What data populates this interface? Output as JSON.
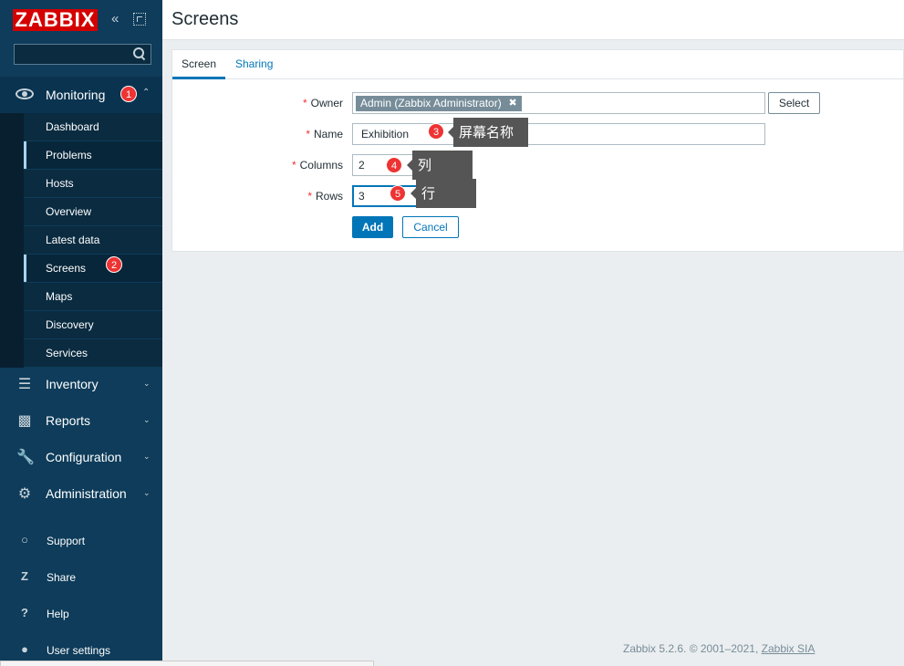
{
  "app": {
    "logo_text": "ZABBIX",
    "brand_color": "#d40000",
    "accent_color": "#0275b8"
  },
  "sidebar": {
    "search": {
      "placeholder": "",
      "value": ""
    },
    "monitoring": {
      "label": "Monitoring",
      "badge": "1",
      "items": [
        {
          "label": "Dashboard"
        },
        {
          "label": "Problems"
        },
        {
          "label": "Hosts"
        },
        {
          "label": "Overview"
        },
        {
          "label": "Latest data"
        },
        {
          "label": "Screens",
          "badge": "2"
        },
        {
          "label": "Maps"
        },
        {
          "label": "Discovery"
        },
        {
          "label": "Services"
        }
      ]
    },
    "sections": [
      {
        "label": "Inventory",
        "icon": "list-icon"
      },
      {
        "label": "Reports",
        "icon": "bar-chart-icon"
      },
      {
        "label": "Configuration",
        "icon": "wrench-icon"
      },
      {
        "label": "Administration",
        "icon": "gear-icon"
      }
    ],
    "utilities": [
      {
        "label": "Support",
        "icon": "headset-icon"
      },
      {
        "label": "Share",
        "icon": "share-icon"
      },
      {
        "label": "Help",
        "icon": "help-icon"
      },
      {
        "label": "User settings",
        "icon": "user-icon"
      }
    ]
  },
  "page": {
    "title": "Screens"
  },
  "tabs": [
    {
      "label": "Screen",
      "active": true
    },
    {
      "label": "Sharing",
      "active": false
    }
  ],
  "form": {
    "owner": {
      "label": "Owner",
      "tag": "Admin (Zabbix Administrator)",
      "select_label": "Select"
    },
    "name": {
      "label": "Name",
      "value": "Exhibition",
      "badge": "3",
      "annotation": "屏幕名称"
    },
    "columns": {
      "label": "Columns",
      "value": "2",
      "badge": "4",
      "annotation": "列"
    },
    "rows": {
      "label": "Rows",
      "value": "3",
      "badge": "5",
      "annotation": "行"
    },
    "add_label": "Add",
    "cancel_label": "Cancel"
  },
  "footer": {
    "text": "Zabbix 5.2.6. © 2001–2021,",
    "link": "Zabbix SIA"
  }
}
